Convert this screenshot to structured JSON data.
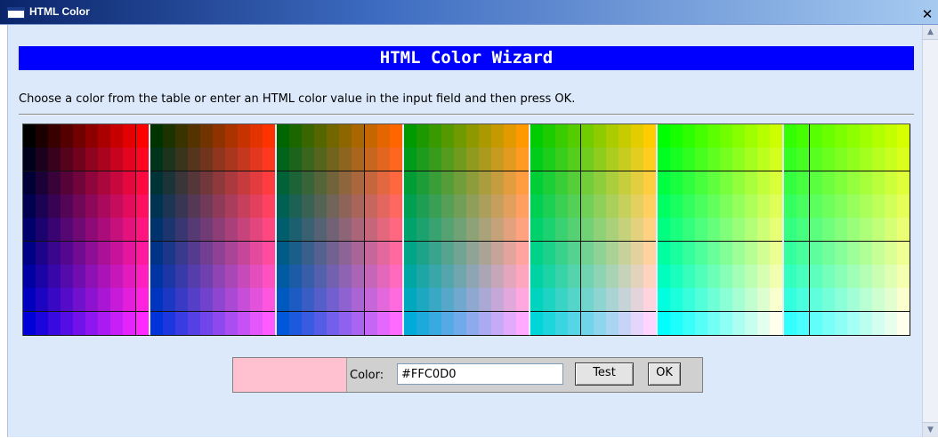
{
  "window": {
    "title": "HTML Color",
    "close_glyph": "✕"
  },
  "dialog": {
    "heading": "HTML Color Wizard",
    "instructions": "Choose a color from the table or enter an HTML color value in the input field and then press OK."
  },
  "palette": {
    "groups": 7,
    "columns_per_group": 10,
    "rows": 9,
    "group_base_colors": [
      "#000000",
      "#003300",
      "#006600",
      "#009900",
      "#00cc00",
      "#00ff00",
      "#33ff00"
    ]
  },
  "form": {
    "preview_color": "#FFC0D0",
    "color_label": "Color:",
    "color_value": "#FFC0D0",
    "test_label": "Test",
    "ok_label": "OK"
  },
  "scrollbar": {
    "up_glyph": "▲",
    "down_glyph": "▼"
  },
  "icons": [
    "window-icon",
    "close-icon",
    "scroll-up-icon",
    "scroll-down-icon"
  ]
}
